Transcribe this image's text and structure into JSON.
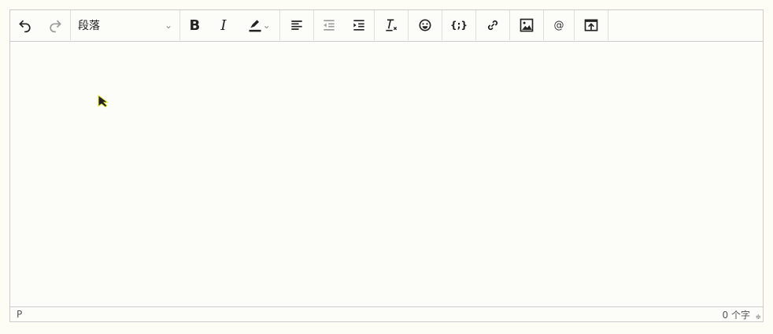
{
  "toolbar": {
    "block_format": "段落",
    "buttons": [
      "undo",
      "redo",
      "bold",
      "italic",
      "highlight",
      "align-left",
      "outdent",
      "indent",
      "remove-format",
      "emoticons",
      "code",
      "link",
      "image",
      "mention",
      "upload"
    ],
    "mention_label": "@"
  },
  "status": {
    "path": "P",
    "word_count": "0 个字"
  }
}
